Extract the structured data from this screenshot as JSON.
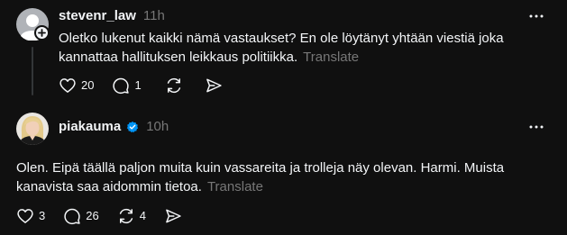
{
  "posts": [
    {
      "username": "stevenr_law",
      "time": "11h",
      "text": "Oletko lukenut kaikki nämä vastaukset? En ole löytänyt yhtään viestiä joka kannattaa hallituksen leikkaus politiikka.",
      "translate_label": "Translate",
      "likes": "20",
      "replies": "1",
      "reposts": "",
      "verified": false
    },
    {
      "username": "piakauma",
      "time": "10h",
      "text": "Olen. Eipä täällä paljon muita kuin vassareita ja trolleja näy olevan. Harmi. Muista kanavista saa aidommin tietoa.",
      "translate_label": "Translate",
      "likes": "3",
      "replies": "26",
      "reposts": "4",
      "verified": true
    }
  ],
  "icons": {
    "like": "heart-icon",
    "reply": "comment-icon",
    "repost": "repost-icon",
    "share": "send-icon",
    "more": "more-horizontal-icon",
    "verified": "verified-badge-icon",
    "follow": "plus-icon"
  },
  "colors": {
    "background": "#101010",
    "text": "#f3f5f7",
    "muted": "#777777",
    "verified": "#0095f6",
    "thread_line": "#333638"
  }
}
